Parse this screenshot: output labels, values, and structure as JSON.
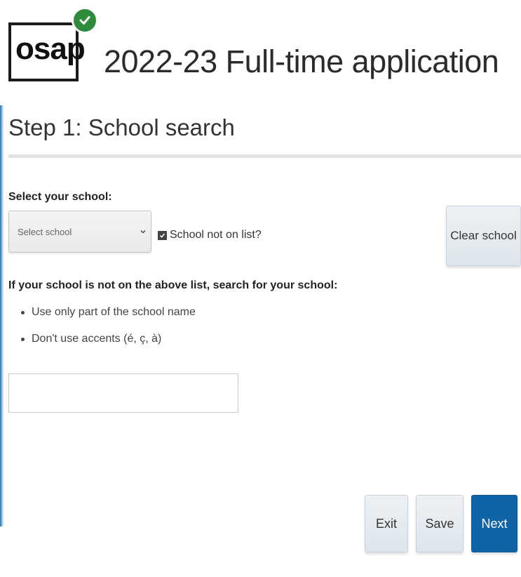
{
  "header": {
    "logo_text": "osap",
    "app_title": "2022-23 Full-time application"
  },
  "step": {
    "title": "Step 1: School search"
  },
  "school_select": {
    "label": "Select your school:",
    "selected_value": "Select school",
    "not_on_list_checkbox": {
      "label": "School not on list?",
      "checked": true
    },
    "clear_button_label": "Clear school"
  },
  "school_search": {
    "heading": "If your school is not on the above list, search for your school:",
    "hints": [
      "Use only part of the school name",
      "Don't use accents (é, ç, à)"
    ],
    "input_value": ""
  },
  "footer": {
    "exit_label": "Exit",
    "save_label": "Save",
    "next_label": "Next"
  },
  "colors": {
    "primary_button": "#0f64a8",
    "logo_check": "#2e8b3c"
  }
}
